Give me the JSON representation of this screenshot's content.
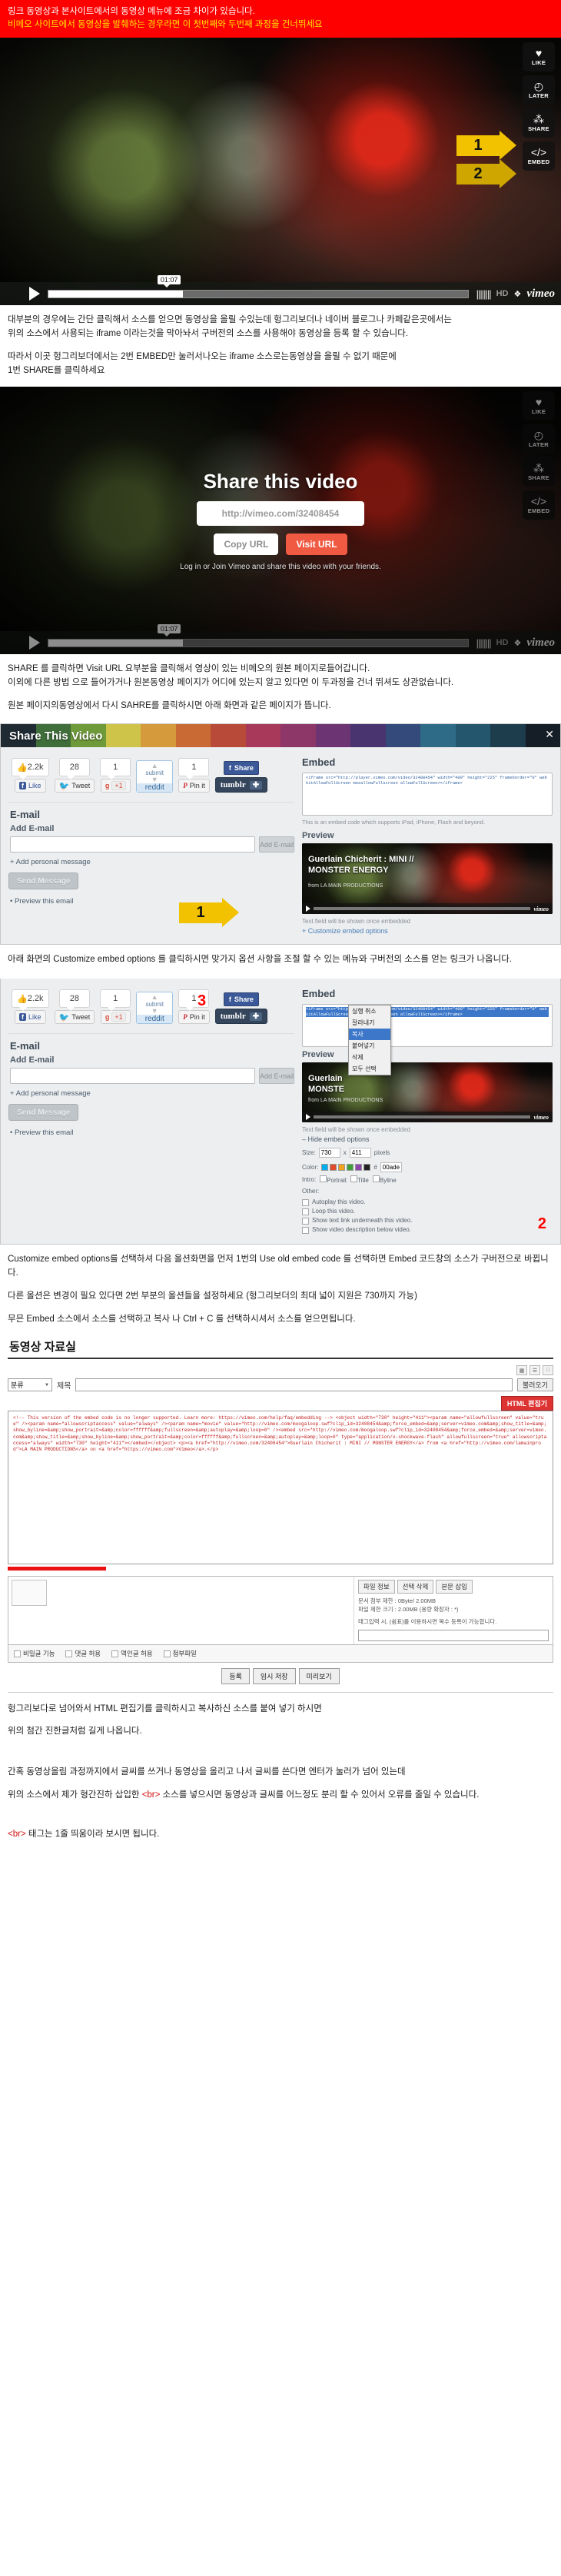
{
  "banner": {
    "line1": "링크 동영상과 본사이트에서의 동영상 메뉴에 조금 차이가 있습니다.",
    "line2": "비메오 사이트에서 동영상을 발췌하는 경우라면 이 첫번째와 두번째 과정을 건너뛰세요"
  },
  "player1": {
    "buttons": [
      {
        "icon": "heart-icon",
        "glyph": "♥",
        "label": "LIKE"
      },
      {
        "icon": "clock-icon",
        "glyph": "◴",
        "label": "LATER"
      },
      {
        "icon": "share-icon",
        "glyph": "⁂",
        "label": "SHARE"
      },
      {
        "icon": "code-icon",
        "glyph": "</>",
        "label": "EMBED"
      }
    ],
    "arrow1": "1",
    "arrow2": "2",
    "time": "01:07",
    "hd": "HD",
    "brand": "vimeo"
  },
  "text1": {
    "p1": "대부분의 경우에는 간단 클릭해서 소스를 얻으면 동영상을 올릴 수있는데 헝그리보더나 네이버 블로그나 카페같은곳에서는",
    "p2": "위의 소스에서 사용되는 iframe 이라는것을 막아놔서 구버전의 소스를 사용해야 동영상을 등록 할 수 있습니다.",
    "p3": "따라서 이곳 헝그리보더에서는 2번 EMBED만 눌러서나오는 iframe 소스로는동영상을 올릴 수 없기 때문에",
    "p4": "1번 SHARE를 클릭하세요"
  },
  "player2": {
    "overlay_title": "Share this video",
    "url": "http://vimeo.com/32408454",
    "copy_label": "Copy URL",
    "visit_label": "Visit URL",
    "footer": "Log in or Join Vimeo and share this video with your friends.",
    "time": "01:07",
    "hd": "HD",
    "brand": "vimeo",
    "buttons": [
      {
        "icon": "heart-icon",
        "glyph": "♥",
        "label": "LIKE"
      },
      {
        "icon": "clock-icon",
        "glyph": "◴",
        "label": "LATER"
      },
      {
        "icon": "share-icon",
        "glyph": "⁂",
        "label": "SHARE"
      },
      {
        "icon": "code-icon",
        "glyph": "</>",
        "label": "EMBED"
      }
    ]
  },
  "text2": {
    "p1": "SHARE 를 클릭하면 Visit URL 요부분을 클릭해서 영상이 있는 비메오의 원본 페이지로들어갑니다.",
    "p2": "이외에 다른 방법 으로 들어가거나 원본동영상 페이지가 어디에 있는지 알고 있다면 이 두과정을 건너 뛰셔도 상관없습니다.",
    "p3": "원본 페이지의동영상에서 다시 SAHRE를 클릭하시면 아래 화면과 같은 페이지가 뜹니다."
  },
  "dialog1": {
    "title": "Share This Video",
    "close": "✕",
    "social": {
      "facebook_count": "2.2k",
      "facebook_label": "Like",
      "twitter_count": "28",
      "twitter_label": "Tweet",
      "google_count": "1",
      "google_label": "+1",
      "reddit_submit": "submit",
      "reddit_label": "reddit",
      "pinterest_count": "1",
      "pinterest_label": "Pin it",
      "fbshare_label": "Share",
      "tumblr_label": "tumblr",
      "tumblr_plus": "✚"
    },
    "email": {
      "heading": "E-mail",
      "field_label": "Add E-mail",
      "value": "",
      "add_button": "Add E-mail",
      "personal_message": "+ Add personal message",
      "send_button": "Send Message",
      "preview": "• Preview this email"
    },
    "embed": {
      "heading": "Embed",
      "code": "<iframe src=\"http://player.vimeo.com/video/32408454\" width=\"400\" height=\"225\" frameborder=\"0\" webkitAllowFullScreen mozallowfullscreen allowFullScreen></iframe>",
      "note": "This is an embed code which supports iPad, iPhone, Flash and beyond.",
      "preview_label": "Preview",
      "preview_title_1": "Guerlain Chicherit : MINI //",
      "preview_title_2": "MONSTER ENERGY",
      "preview_sub": "from LA MAIN PRODUCTIONS",
      "preview_brand": "vimeo",
      "text_field_note": "Text field will be shown once embedded",
      "customize_link": "+ Customize embed options"
    }
  },
  "text3": {
    "p1": "아래 화면의 Customize embed options 를 클릭하시면 맞가지 옵션 사항을 조절 할 수 있는 메뉴와 구버전의 소스를 얻는 링크가 나옵니다."
  },
  "dialog2": {
    "social": {
      "facebook_count": "2.2k",
      "facebook_label": "Like",
      "twitter_count": "28",
      "twitter_label": "Tweet",
      "google_count": "1",
      "google_label": "+1",
      "reddit_submit": "submit",
      "reddit_label": "reddit",
      "pinterest_count": "1",
      "pinterest_label": "Pin it",
      "fbshare_label": "Share",
      "tumblr_label": "tumblr",
      "tumblr_plus": "✚"
    },
    "email": {
      "heading": "E-mail",
      "field_label": "Add E-mail",
      "value": "",
      "add_button": "Add E-mail",
      "personal_message": "+ Add personal message",
      "send_button": "Send Message",
      "preview": "• Preview this email"
    },
    "embed": {
      "heading": "Embed",
      "code_selected": "<iframe src=\"http://player.vimeo.com/video/32408454\" width=\"400\" height=\"225\" frameborder=\"0\" webkitAllowFullScreen mozallowfullscreen allowFullScreen></iframe>",
      "context_menu": [
        {
          "label": "실행 취소",
          "selected": false
        },
        {
          "label": "잘라내기",
          "selected": false
        },
        {
          "label": "복사",
          "selected": true
        },
        {
          "label": "붙여넣기",
          "selected": false
        },
        {
          "label": "삭제",
          "selected": false
        },
        {
          "label": "모두 선택",
          "selected": false
        }
      ],
      "hide_link": "– Hide embed options",
      "size_label": "Size:",
      "width": "730",
      "height": "411",
      "size_unit": "pixels",
      "color_label": "Color:",
      "color_value": "00adef",
      "color_swatches": [
        "#00adef",
        "#e04b2a",
        "#f4a11c",
        "#3e9e3a",
        "#8e44ad",
        "#222222"
      ],
      "intro_label": "Intro:",
      "intro_options": [
        "Portrait",
        "Title",
        "Byline"
      ],
      "other_label": "Other:",
      "other_options": [
        "Autoplay this video.",
        "Loop this video.",
        "Show text link underneath this video.",
        "Show video description below video."
      ],
      "preview_label": "Preview",
      "preview_title_1": "Guerlain",
      "preview_title_2": "MONSTE",
      "preview_sub": "from LA MAIN PRODUCTIONS",
      "preview_brand": "vimeo",
      "text_field_note": "Text field will be shown once embedded"
    },
    "marker_3": "3",
    "marker_2": "2"
  },
  "text4": {
    "p1": "Customize embed options를 선택하셔 다음 올션화면을 먼저 1번의 Use old embed code 를 선택하면 Embed 코드창의 소스가 구버전으로 바뀝니다.",
    "p2": "다른 올션은 변경이 필요 있다면 2번 부분의 올션들을 설정하세요 (헝그리보더의 최대 넓이 지원은 730까지 가능)",
    "p3": "무믄 Embed 소스에서 소스를 선택하고 복사 나 Ctrl + C 를 선택하시셔서 소스를 얻으면됩니다."
  },
  "vault": {
    "title": "동영상 자료실",
    "toolbar_icons": [
      "grid-icon",
      "list-icon",
      "card-icon"
    ],
    "category_label": "분류",
    "keyword_label": "제목",
    "search_value": "",
    "search_button": "불러오기",
    "html_button": "HTML 편집기",
    "editor_code": "<!-- This version of the embed code is no longer supported. Learn more: https://vimeo.com/help/faq/embedding --> <object width=\"730\" height=\"411\"><param name=\"allowfullscreen\" value=\"true\" /><param name=\"allowscriptaccess\" value=\"always\" /><param name=\"movie\" value=\"http://vimeo.com/moogaloop.swf?clip_id=32408454&amp;force_embed=&amp;server=vimeo.com&amp;show_title=&amp;show_byline=&amp;show_portrait=&amp;color=ffffff&amp;fullscreen=&amp;autoplay=&amp;loop=0\" /><embed src=\"http://vimeo.com/moogaloop.swf?clip_id=32408454&amp;force_embed=&amp;server=vimeo.com&amp;show_title=&amp;show_byline=&amp;show_portrait=&amp;color=ffffff&amp;fullscreen=&amp;autoplay=&amp;loop=0\" type=\"application/x-shockwave-flash\" allowfullscreen=\"true\" allowscriptaccess=\"always\" width=\"730\" height=\"411\"></embed></object> <p><a href=\"http://vimeo.com/32408454\">Guerlain Chicherit : MINI // MONSTER ENERGY</a> from <a href=\"http://vimeo.com/lamainprod\">LA MAIN PRODUCTIONS</a> on <a href=\"https://vimeo.com\">Vimeo</a>.</p>",
    "attach": {
      "file_info_btn": "파일 정보",
      "select_delete_btn": "선택 삭제",
      "insert_btn": "본문 삽입",
      "info_line1": "문서 첨부 제한 : 0Byte/ 2.00MB",
      "info_line2": "파일 제한 크기 : 2.00MB (용량 확장자 : *)",
      "tag_label": "태그입력 시, (쉼표)를 이용하시면 복수 등록이 가능합니다.",
      "tag_value": ""
    },
    "options": [
      "비밀글 기능",
      "댓글 허용",
      "역인글 허용",
      "첨부파일"
    ],
    "buttons": [
      "등록",
      "임시 저장",
      "미리보기"
    ]
  },
  "footer": {
    "p1": "헝그리보다로 넘어와서 HTML 편집기를 클릭하시고 복사하신 소스를 붙여 넣기 하시면",
    "p2": "위의 첨간 진한글처럼 길게 나옵니다.",
    "p3": "간혹 동영상올림 과정까지에서 글씨를 쓰거나 동영상을 올리고 나서 글씨를 쓴다면 엔터가 눌러가 넘어 있는데",
    "p4_pre": "위의 소스에서 제가 형간진하 삽입한 ",
    "p4_red": "<br>",
    "p4_post": " 소스를 넣으시면 동영상과 글씨를 어느정도 분리 할 수 있어서 오류를 줄일 수 있습니다.",
    "p5_pre": "",
    "p5_red": "<br>",
    "p5_post": " 태그는 1줄 띄움이라 보시면 됩니다."
  }
}
